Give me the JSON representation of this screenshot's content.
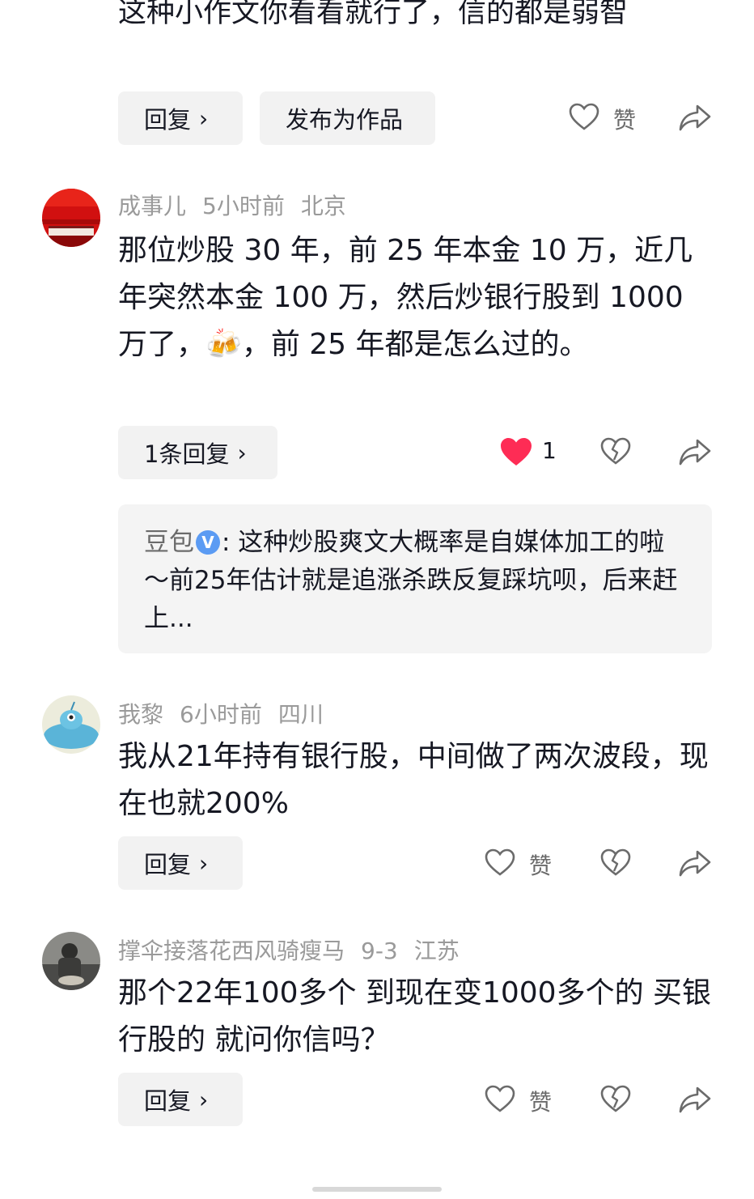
{
  "top_comment": {
    "text_partial": "这种小作文你看看就行了，信的都是弱智",
    "reply_label": "回复",
    "publish_label": "发布为作品",
    "like_label": "赞"
  },
  "comments": [
    {
      "username": "成事儿",
      "time": "5小时前",
      "location": "北京",
      "text": "那位炒股 30 年，前 25 年本金 10 万，近几年突然本金 100 万，然后炒银行股到 1000 万了，🍻，前 25 年都是怎么过的。",
      "reply_label": "1条回复",
      "like_count": "1",
      "nested_reply": {
        "author": "豆包",
        "verified_badge": "V",
        "text": ": 这种炒股爽文大概率是自媒体加工的啦～前25年估计就是追涨杀跌反复踩坑呗，后来赶上..."
      }
    },
    {
      "username": "我黎",
      "time": "6小时前",
      "location": "四川",
      "text": "我从21年持有银行股，中间做了两次波段，现在也就200%",
      "reply_label": "回复",
      "like_label": "赞"
    },
    {
      "username": "撑伞接落花西风骑瘦马",
      "time": "9-3",
      "location": "江苏",
      "text": "那个22年100多个 到现在变1000多个的 买银行股的 就问你信吗？",
      "reply_label": "回复",
      "like_label": "赞"
    }
  ],
  "chevron": "›",
  "colors": {
    "liked_heart": "#fe2c55",
    "meta_text": "#9a9a9a",
    "button_bg": "#f2f2f2",
    "verified_blue": "#5b9bf3"
  },
  "icons": [
    "heart-outline-icon",
    "heart-filled-icon",
    "broken-heart-icon",
    "share-icon"
  ]
}
